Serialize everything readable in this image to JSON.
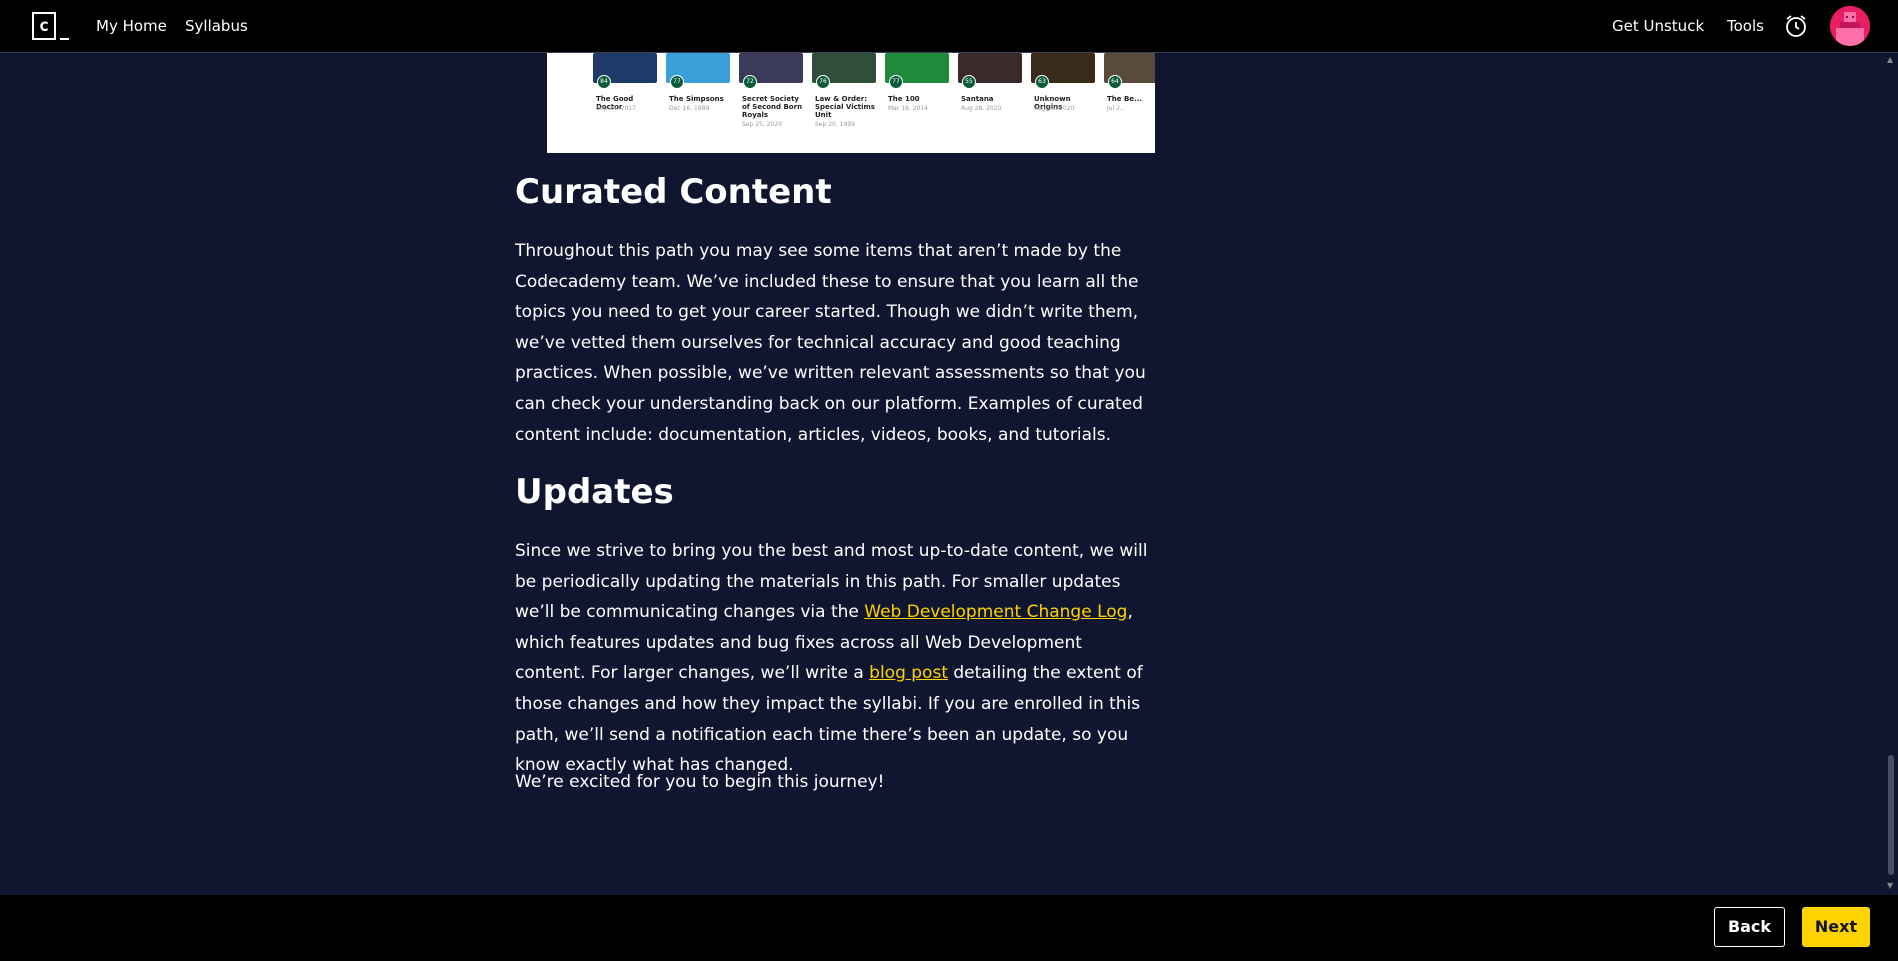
{
  "nav": {
    "logo_letter": "c",
    "my_home": "My Home",
    "syllabus": "Syllabus",
    "get_unstuck": "Get Unstuck",
    "tools": "Tools",
    "alarm_icon": "alarm-clock-icon",
    "avatar_icon": "avatar"
  },
  "thumbnails": [
    {
      "badge": "84",
      "title": "The Good Doctor",
      "date": "Sep 25, 2017",
      "color": "#1e3a68"
    },
    {
      "badge": "77",
      "title": "The Simpsons",
      "date": "Dec 16, 1989",
      "color": "#3aa0d8"
    },
    {
      "badge": "72",
      "title": "Secret Society of Second Born Royals",
      "date": "Sep 25, 2020",
      "color": "#3c3a5a"
    },
    {
      "badge": "76",
      "title": "Law & Order: Special Victims Unit",
      "date": "Sep 20, 1999",
      "color": "#2f4f3a"
    },
    {
      "badge": "77",
      "title": "The 100",
      "date": "Mar 19, 2014",
      "color": "#1f8a3a"
    },
    {
      "badge": "55",
      "title": "Santana",
      "date": "Aug 28, 2020",
      "color": "#3a2a2a"
    },
    {
      "badge": "63",
      "title": "Unknown Origins",
      "date": "Aug 28, 2020",
      "color": "#3a2a1a"
    },
    {
      "badge": "64",
      "title": "The Be...",
      "date": "Jul 2...",
      "color": "#5a4a3a"
    }
  ],
  "curated": {
    "heading": "Curated Content",
    "body": "Throughout this path you may see some items that aren’t made by the Codecademy team. We’ve included these to ensure that you learn all the topics you need to get your career started. Though we didn’t write them, we’ve vetted them ourselves for technical accuracy and good teaching practices. When possible, we’ve written relevant assessments so that you can check your understanding back on our platform. Examples of curated content include: documentation, articles, videos, books, and tutorials."
  },
  "updates": {
    "heading": "Updates",
    "part1": "Since we strive to bring you the best and most up-to-date content, we will be periodically updating the materials in this path. For smaller updates we’ll be communicating changes via the ",
    "link1": "Web Development Change Log",
    "part2": ", which features updates and bug fixes across all Web Development content. For larger changes, we’ll write a ",
    "link2": "blog post",
    "part3": " detailing the extent of those changes and how they impact the syllabi. If you are enrolled in this path, we’ll send a notification each time there’s been an update, so you know exactly what has changed."
  },
  "closing": "We’re excited for you to begin this journey!",
  "footer": {
    "back": "Back",
    "next": "Next"
  },
  "colors": {
    "background": "#10162f",
    "link": "#ffd300",
    "next_button": "#ffd300"
  }
}
